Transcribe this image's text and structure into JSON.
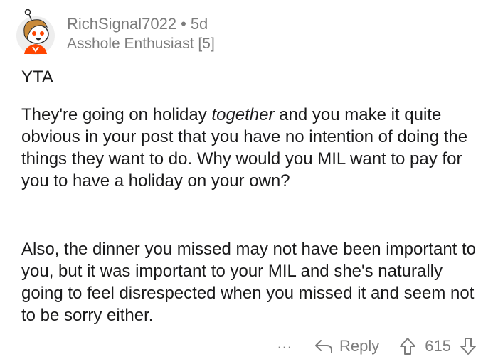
{
  "comment": {
    "username": "RichSignal7022",
    "separator": "•",
    "age": "5d",
    "flair": "Asshole Enthusiast [5]",
    "verdict": "YTA",
    "paragraph1": {
      "before": "They're going on holiday ",
      "emphasis": "together",
      "after": " and you make it quite obvious in your post that you have no intention of doing the things they want to do.  Why would you MIL want to pay for you to have a holiday on your own?"
    },
    "paragraph2": "Also, the dinner you missed may not have been important to you, but it was important to your MIL and she's naturally going to feel disrespected when you missed it and seem not to be sorry either."
  },
  "actions": {
    "more": "...",
    "reply_label": "Reply",
    "score": "615"
  },
  "icons": {
    "avatar": "snoo-avatar-icon",
    "reply": "reply-arrow-icon",
    "upvote": "upvote-arrow-icon",
    "downvote": "downvote-arrow-icon"
  },
  "colors": {
    "text": "#1a1a1b",
    "meta": "#7c7c7c",
    "avatar_orange": "#ff4500",
    "avatar_hair": "#c88a3a"
  }
}
